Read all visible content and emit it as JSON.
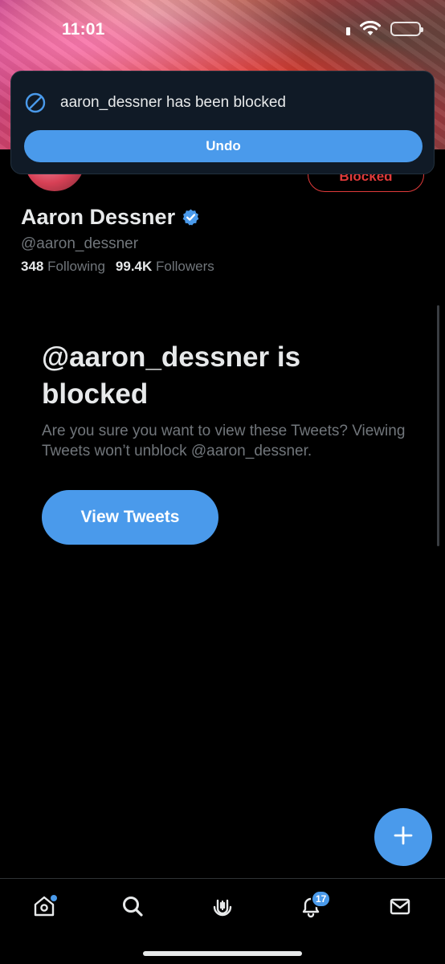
{
  "status_bar": {
    "time": "11:01"
  },
  "toast": {
    "message": "aaron_dessner has been blocked",
    "undo_label": "Undo",
    "icon": "block-icon"
  },
  "profile": {
    "name": "Aaron Dessner",
    "handle": "@aaron_dessner",
    "following_count": "348",
    "following_label": "Following",
    "followers_count": "99.4K",
    "followers_label": "Followers",
    "blocked_button_label": "Blocked",
    "verified": true
  },
  "blocked_notice": {
    "title": "@aaron_dessner is blocked",
    "description": "Are you sure you want to view these Tweets? Viewing Tweets won’t unblock @aaron_dessner.",
    "view_button_label": "View Tweets"
  },
  "bottom_nav": {
    "items": [
      {
        "name": "home",
        "icon": "home-icon"
      },
      {
        "name": "search",
        "icon": "search-icon"
      },
      {
        "name": "spaces",
        "icon": "spaces-icon"
      },
      {
        "name": "notifications",
        "icon": "bell-icon",
        "badge": "17"
      },
      {
        "name": "messages",
        "icon": "envelope-icon"
      }
    ]
  },
  "colors": {
    "accent": "#4a9aeb",
    "blocked_red": "#e03a3a",
    "background": "#000000",
    "muted_text": "#71767b"
  }
}
